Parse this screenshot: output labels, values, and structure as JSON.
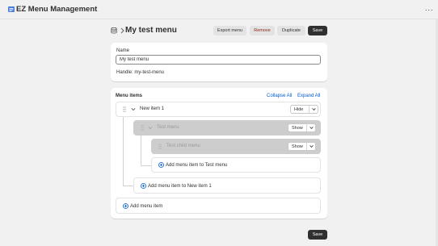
{
  "app": {
    "title": "EZ Menu Management",
    "more_label": "···"
  },
  "header": {
    "title": "My test menu",
    "export_label": "Export menu",
    "remove_label": "Remove",
    "duplicate_label": "Duplicate",
    "save_label": "Save"
  },
  "name_card": {
    "name_label": "Name",
    "name_value": "My test menu",
    "handle_text": "Handle: my-test-menu"
  },
  "menu_items": {
    "title": "Menu items",
    "collapse_all": "Collapse All",
    "expand_all": "Expand All",
    "items": [
      {
        "label": "New item 1",
        "visibility": "Hide",
        "hidden": false
      },
      {
        "label": "Test menu",
        "visibility": "Show",
        "hidden": true
      },
      {
        "label": "Test child menu",
        "visibility": "Show",
        "hidden": true
      }
    ],
    "add_to_test_menu": "Add menu item to Test menu",
    "add_to_new_item": "Add menu item to New item 1",
    "add_root": "Add menu item"
  },
  "footer": {
    "save_label": "Save"
  },
  "colors": {
    "primary": "#303030",
    "link": "#005bd3",
    "critical": "#8e1f0b",
    "hidden_row": "#cdcdcd"
  }
}
